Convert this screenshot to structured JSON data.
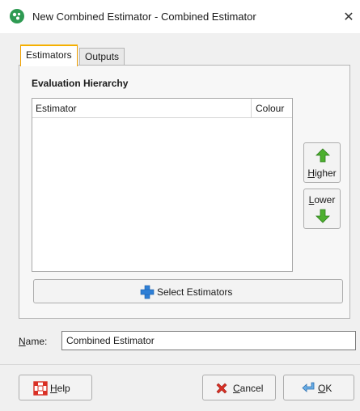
{
  "window": {
    "title": "New Combined Estimator - Combined Estimator",
    "close_label": "✕"
  },
  "tabs": [
    {
      "label": "Estimators",
      "active": true
    },
    {
      "label": "Outputs",
      "active": false
    }
  ],
  "hierarchy": {
    "title": "Evaluation Hierarchy",
    "columns": [
      "Estimator",
      "Colour"
    ],
    "rows": []
  },
  "order_buttons": {
    "higher": {
      "label_accel": "H",
      "label_rest": "igher"
    },
    "lower": {
      "label_accel": "L",
      "label_rest": "ower"
    }
  },
  "select_button": {
    "label": "Select Estimators"
  },
  "name_field": {
    "label_accel": "N",
    "label_rest": "ame:",
    "value": "Combined Estimator"
  },
  "footer": {
    "help": {
      "label_accel": "H",
      "label_rest": "elp"
    },
    "cancel": {
      "label_accel": "C",
      "label_rest": "ancel"
    },
    "ok": {
      "label_accel": "O",
      "label_rest": "K"
    }
  },
  "colors": {
    "active_tab_accent": "#f5b000",
    "arrow_green": "#4caf2e",
    "plus_blue": "#2f7fd6",
    "cancel_red": "#d93025"
  }
}
